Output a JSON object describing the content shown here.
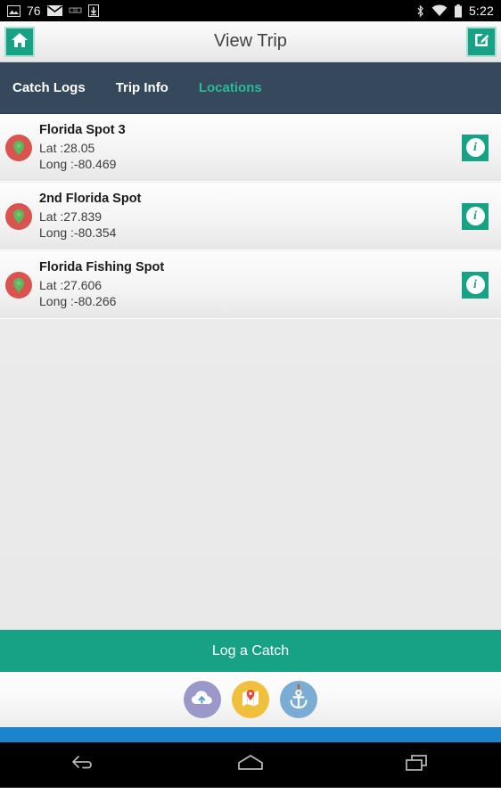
{
  "statusbar": {
    "image_icon": "image-icon",
    "count": "76",
    "mail_icon": "mail-icon",
    "signal_icon": "signal-icon",
    "download_icon": "download-icon",
    "bluetooth_icon": "bluetooth-icon",
    "wifi_icon": "wifi-icon",
    "battery_icon": "battery-icon",
    "time": "5:22"
  },
  "titlebar": {
    "home_icon": "home-icon",
    "title": "View Trip",
    "edit_icon": "edit-icon"
  },
  "tabs": [
    {
      "label": "Catch Logs",
      "active": false
    },
    {
      "label": "Trip Info",
      "active": false
    },
    {
      "label": "Locations",
      "active": true
    }
  ],
  "locations": [
    {
      "name": "Florida Spot 3",
      "lat": "Lat :28.05",
      "long": "Long :-80.469",
      "info_label": "i"
    },
    {
      "name": "2nd Florida Spot",
      "lat": "Lat :27.839",
      "long": "Long :-80.354",
      "info_label": "i"
    },
    {
      "name": "Florida Fishing Spot",
      "lat": "Lat :27.606",
      "long": "Long :-80.266",
      "info_label": "i"
    }
  ],
  "cta": {
    "label": "Log a Catch"
  },
  "dock": [
    {
      "name": "cloud-upload-icon",
      "color": "#9a98c8"
    },
    {
      "name": "map-pin-icon",
      "color": "#f0c03c"
    },
    {
      "name": "anchor-icon",
      "color": "#7bacd4"
    }
  ],
  "navbar": {
    "back_icon": "back-icon",
    "home_icon": "home-icon",
    "recents_icon": "recents-icon"
  },
  "colors": {
    "accent_teal": "#17a185",
    "tabbar": "#36485c",
    "tab_active": "#27bb9a",
    "pin_red": "#d9534f",
    "pin_green": "#5cb85c",
    "blue_strip": "#1b84cd"
  }
}
